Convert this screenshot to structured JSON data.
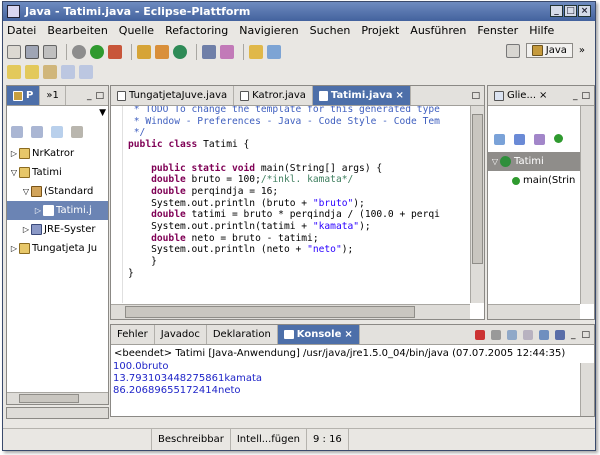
{
  "window": {
    "title": "Java - Tatimi.java - Eclipse-Plattform",
    "controls": [
      "_",
      "□",
      "×"
    ]
  },
  "menu": [
    "Datei",
    "Bearbeiten",
    "Quelle",
    "Refactoring",
    "Navigieren",
    "Suchen",
    "Projekt",
    "Ausführen",
    "Fenster",
    "Hilfe"
  ],
  "perspective": {
    "label": "Java",
    "more": "»"
  },
  "package_explorer": {
    "tabs": [
      "P",
      "»1"
    ],
    "controls": [
      "▼",
      "_",
      "□"
    ],
    "items": [
      {
        "label": "NrKatror",
        "twisty": "▷"
      },
      {
        "label": "Tatimi",
        "twisty": "▽"
      },
      {
        "label": "(Standard",
        "twisty": "▽"
      },
      {
        "label": "Tatimi.j",
        "twisty": "▷"
      },
      {
        "label": "JRE-Syster",
        "twisty": "▷"
      },
      {
        "label": "Tungatjeta Ju",
        "twisty": "▷"
      }
    ]
  },
  "editor": {
    "tabs": [
      "TungatjetaJuve.java",
      "Katror.java",
      "Tatimi.java"
    ],
    "lines": [
      " * TODO To change the template for this generated type",
      " * Window - Preferences - Java - Code Style - Code Tem",
      " */",
      "public class Tatimi {",
      "",
      "    public static void main(String[] args) {",
      "    double bruto = 100;/*inkl. kamata*/",
      "    double perqindja = 16;",
      "    System.out.println (bruto + \"bruto\");",
      "    double tatimi = bruto * perqindja / (100.0 + perqi",
      "    System.out.println(tatimi + \"kamata\");",
      "    double neto = bruto - tatimi;",
      "    System.out.println (neto + \"neto\");",
      "    }",
      "}"
    ]
  },
  "outline": {
    "tab": "Glie...",
    "items": [
      {
        "label": "Tatimi"
      },
      {
        "label": "main(Strin"
      }
    ]
  },
  "bottom": {
    "tabs": [
      "Fehler",
      "Javadoc",
      "Deklaration",
      "Konsole"
    ],
    "header": "<beendet> Tatimi [Java-Anwendung] /usr/java/jre1.5.0_04/bin/java (07.07.2005 12:44:35)",
    "output": [
      "100.0bruto",
      "13.793103448275861kamata",
      "86.20689655172414neto"
    ]
  },
  "status": {
    "writable": "Beschreibbar",
    "insert": "Intell...fügen",
    "position": "9 : 16"
  },
  "colors": {
    "title": "#43629d",
    "accent": "#4d6fa9",
    "keyword": "#7f0055",
    "string": "#2a00ff",
    "javadoc": "#3f5fbf",
    "console_output": "#1f25c8"
  }
}
